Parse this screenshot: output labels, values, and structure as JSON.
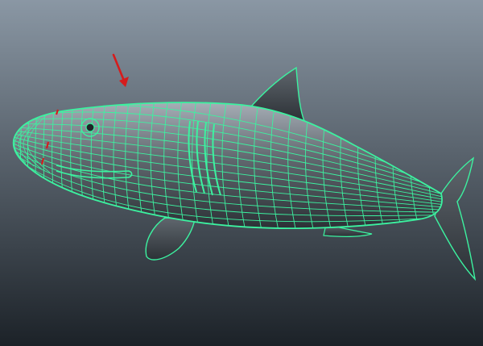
{
  "viewport": {
    "background_top": "#8a97a4",
    "background_bottom": "#1c2228"
  },
  "model": {
    "name": "shark",
    "wire_color": "#3cf2a0",
    "shade_light": "#a6aeb6",
    "shade_mid": "#60676e",
    "shade_dark": "#2c3136"
  },
  "annotation": {
    "icon": "red-arrow-icon",
    "color": "#d61c1c"
  }
}
